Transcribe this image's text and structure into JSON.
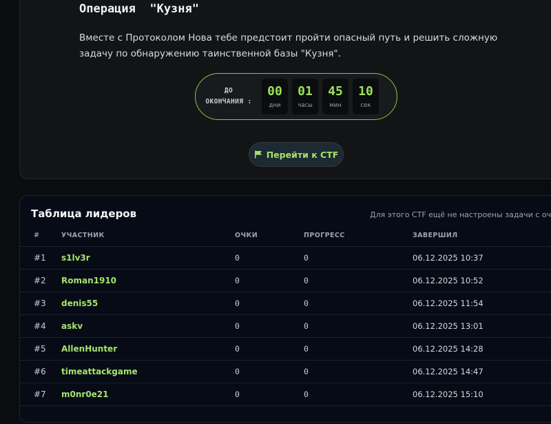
{
  "ctf": {
    "title": "Операция  \"Кузня\"",
    "description": "Вместе с Протоколом Нова тебе предстоит пройти опасный путь и решить сложную задачу по обнаружению таинственной базы \"Кузня\".",
    "timer": {
      "label_line1": "ДО",
      "label_line2": "ОКОНЧАНИЯ :",
      "units": [
        {
          "value": "00",
          "unit": "дни"
        },
        {
          "value": "01",
          "unit": "часы"
        },
        {
          "value": "45",
          "unit": "мин"
        },
        {
          "value": "10",
          "unit": "сек"
        }
      ]
    },
    "button_label": "Перейти к CTF",
    "button_icon": "flag-icon",
    "accent_color": "#9be15d"
  },
  "leaderboard": {
    "title": "Таблица лидеров",
    "note": "Для этого CTF ещё не настроены задачи с очками",
    "columns": {
      "rank": "#",
      "participant": "УЧАСТНИК",
      "score": "ОЧКИ",
      "progress": "ПРОГРЕСС",
      "finished": "ЗАВЕРШИЛ"
    },
    "rows": [
      {
        "rank": "#1",
        "name": "s1lv3r",
        "score": "0",
        "progress": "0",
        "finished": "06.12.2025 10:37"
      },
      {
        "rank": "#2",
        "name": "Roman1910",
        "score": "0",
        "progress": "0",
        "finished": "06.12.2025 10:52"
      },
      {
        "rank": "#3",
        "name": "denis55",
        "score": "0",
        "progress": "0",
        "finished": "06.12.2025 11:54"
      },
      {
        "rank": "#4",
        "name": "askv",
        "score": "0",
        "progress": "0",
        "finished": "06.12.2025 13:01"
      },
      {
        "rank": "#5",
        "name": "AllenHunter",
        "score": "0",
        "progress": "0",
        "finished": "06.12.2025 14:28"
      },
      {
        "rank": "#6",
        "name": "timeattackgame",
        "score": "0",
        "progress": "0",
        "finished": "06.12.2025 14:47"
      },
      {
        "rank": "#7",
        "name": "m0nr0e21",
        "score": "0",
        "progress": "0",
        "finished": "06.12.2025 15:10"
      }
    ]
  }
}
